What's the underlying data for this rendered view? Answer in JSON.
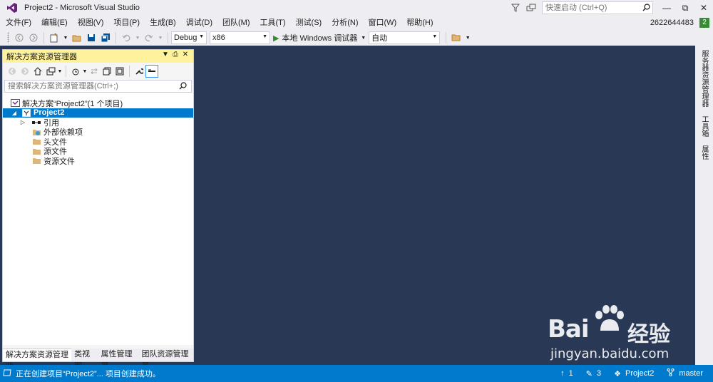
{
  "window": {
    "title": "Project2 - Microsoft Visual Studio",
    "quick_launch_placeholder": "快速启动 (Ctrl+Q)",
    "notification_count": "2",
    "account": "2622644483"
  },
  "menu": {
    "items": [
      "文件(F)",
      "编辑(E)",
      "视图(V)",
      "项目(P)",
      "生成(B)",
      "调试(D)",
      "团队(M)",
      "工具(T)",
      "测试(S)",
      "分析(N)",
      "窗口(W)",
      "帮助(H)"
    ]
  },
  "toolbar": {
    "configuration": "Debug",
    "platform": "x86",
    "run_label": "本地 Windows 调试器",
    "auto_label": "自动"
  },
  "solution_explorer": {
    "title": "解决方案资源管理器",
    "search_placeholder": "搜索解决方案资源管理器(Ctrl+;)",
    "tree": {
      "solution": "解决方案“Project2”(1 个项目)",
      "project": "Project2",
      "references": "引用",
      "external_deps": "外部依赖项",
      "headers": "头文件",
      "sources": "源文件",
      "resources": "资源文件"
    },
    "tabs": [
      "解决方案资源管理器",
      "类视图",
      "属性管理器",
      "团队资源管理器"
    ]
  },
  "right_rail": {
    "tabs": [
      "服务器资源管理器",
      "工具箱",
      "属性"
    ]
  },
  "status": {
    "message": "正在创建项目“Project2”... 项目创建成功。",
    "up_count": "1",
    "edit_count": "3",
    "project": "Project2",
    "branch": "master"
  },
  "watermark": {
    "brand": "Bai",
    "brand2": "经验",
    "url": "jingyan.baidu.com"
  },
  "colors": {
    "accent": "#007acc",
    "editor_bg": "#293955",
    "chrome": "#eeeef2",
    "tool_window_header": "#fff29d"
  }
}
